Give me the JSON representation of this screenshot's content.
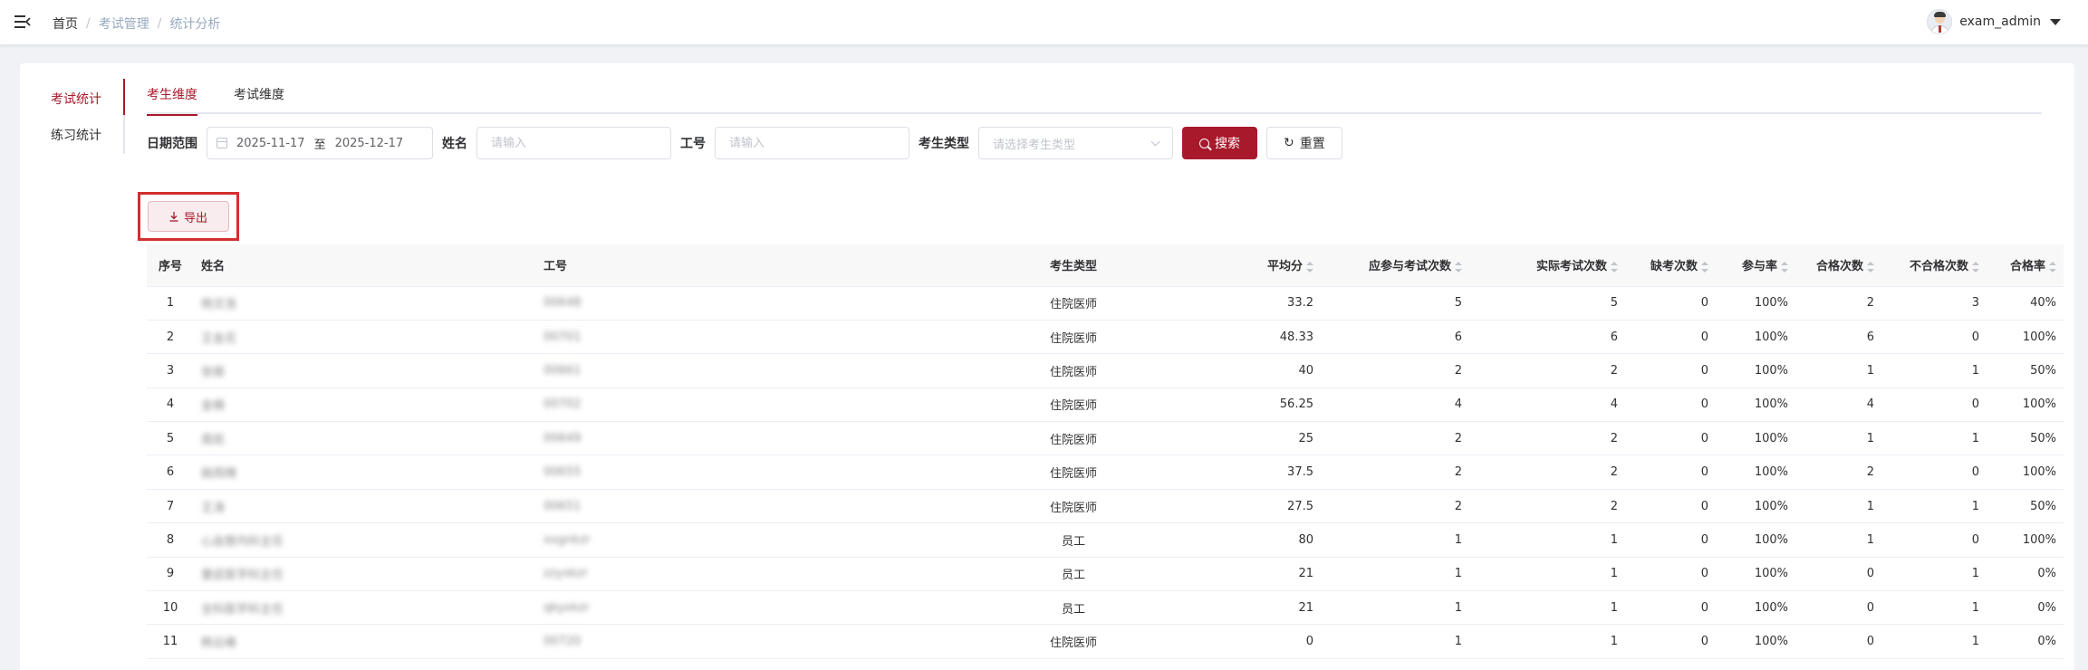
{
  "breadcrumb": [
    "首页",
    "考试管理",
    "统计分析"
  ],
  "user": {
    "name": "exam_admin"
  },
  "side_tabs": [
    "考试统计",
    "练习统计"
  ],
  "top_tabs": [
    "考生维度",
    "考试维度"
  ],
  "filters": {
    "date_label": "日期范围",
    "date_start": "2025-11-17",
    "date_sep": "至",
    "date_end": "2025-12-17",
    "name_label": "姓名",
    "name_placeholder": "请输入",
    "job_label": "工号",
    "job_placeholder": "请输入",
    "type_label": "考生类型",
    "type_placeholder": "请选择考生类型",
    "search_button": "搜索",
    "reset_button": "重置"
  },
  "export_button": "导出",
  "table": {
    "headers": [
      "序号",
      "姓名",
      "工号",
      "考生类型",
      "平均分",
      "应参与考试次数",
      "实际考试次数",
      "缺考次数",
      "参与率",
      "合格次数",
      "不合格次数",
      "合格率"
    ],
    "rows": [
      [
        "1",
        "杨文浩",
        "00648",
        "住院医师",
        "33.2",
        "5",
        "5",
        "0",
        "100%",
        "2",
        "3",
        "40%"
      ],
      [
        "2",
        "王金花",
        "00701",
        "住院医师",
        "48.33",
        "6",
        "6",
        "0",
        "100%",
        "6",
        "0",
        "100%"
      ],
      [
        "3",
        "张振",
        "00661",
        "住院医师",
        "40",
        "2",
        "2",
        "0",
        "100%",
        "1",
        "1",
        "50%"
      ],
      [
        "4",
        "金楠",
        "00702",
        "住院医师",
        "56.25",
        "4",
        "4",
        "0",
        "100%",
        "4",
        "0",
        "100%"
      ],
      [
        "5",
        "周凯",
        "00649",
        "住院医师",
        "25",
        "2",
        "2",
        "0",
        "100%",
        "1",
        "1",
        "50%"
      ],
      [
        "6",
        "姚雨晴",
        "00655",
        "住院医师",
        "37.5",
        "2",
        "2",
        "0",
        "100%",
        "2",
        "0",
        "100%"
      ],
      [
        "7",
        "王涛",
        "00651",
        "住院医师",
        "27.5",
        "2",
        "2",
        "0",
        "100%",
        "1",
        "1",
        "50%"
      ],
      [
        "8",
        "心血管内科主任",
        "xxgnkzr",
        "员工",
        "80",
        "1",
        "1",
        "0",
        "100%",
        "1",
        "0",
        "100%"
      ],
      [
        "9",
        "重症医学科主任",
        "zzyxkzr",
        "员工",
        "21",
        "1",
        "1",
        "0",
        "100%",
        "0",
        "1",
        "0%"
      ],
      [
        "10",
        "全科医学科主任",
        "qkyxkzr",
        "员工",
        "21",
        "1",
        "1",
        "0",
        "100%",
        "0",
        "1",
        "0%"
      ],
      [
        "11",
        "韩云峰",
        "00720",
        "住院医师",
        "0",
        "1",
        "1",
        "0",
        "100%",
        "0",
        "1",
        "0%"
      ]
    ]
  },
  "colors": {
    "accent": "#a8192b",
    "highlight_box": "#d32f2f"
  }
}
